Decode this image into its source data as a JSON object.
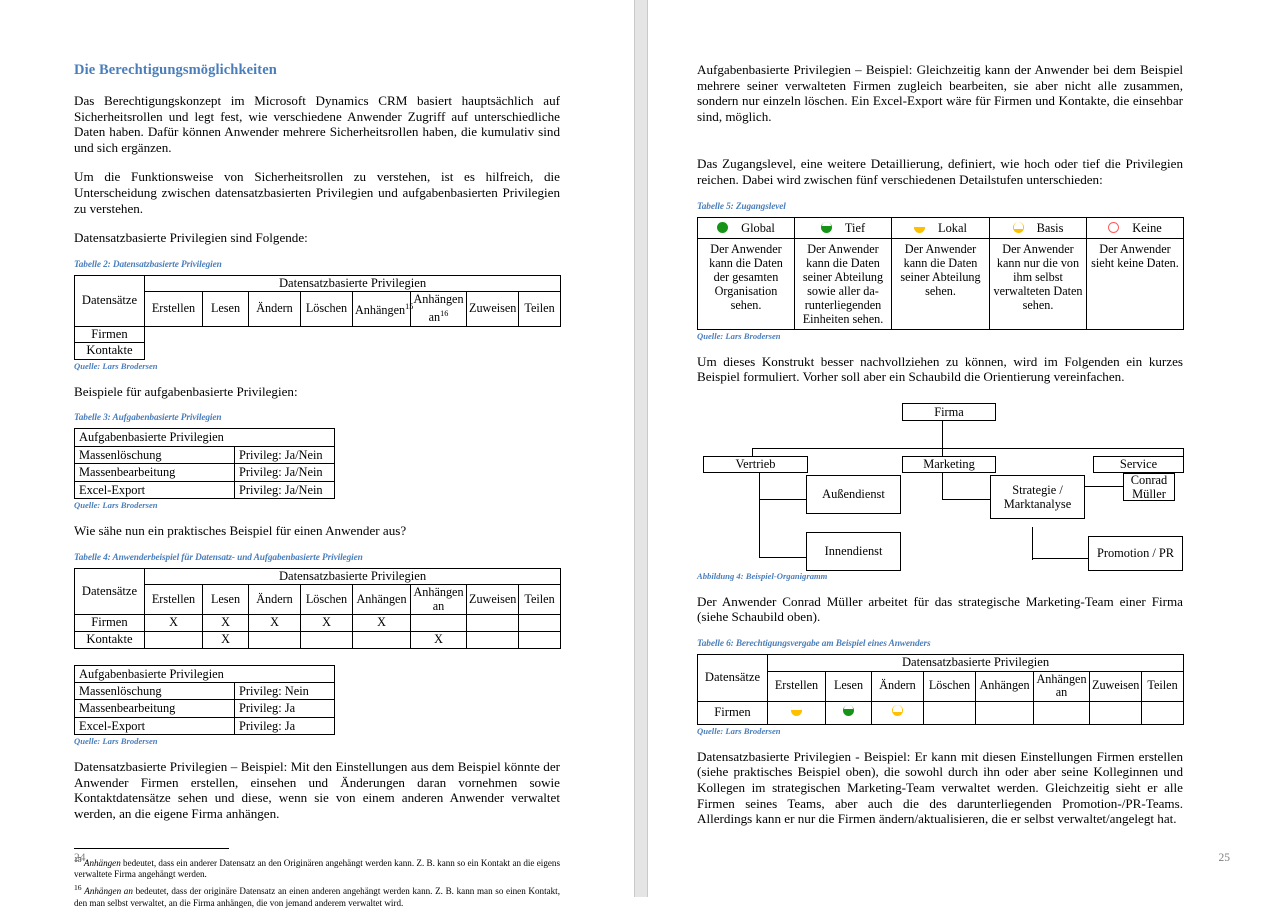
{
  "document": {
    "left_page": {
      "page_number": "24",
      "heading": "Die Berechtigungsmöglichkeiten",
      "paragraphs": {
        "p1": "Das Berechtigungskonzept im Microsoft Dynamics CRM basiert hauptsächlich auf Sicherheitsrollen und legt fest, wie verschiedene Anwender Zugriff auf unterschiedliche Daten haben. Dafür können Anwender mehrere Sicherheitsrollen haben, die kumulativ sind und sich ergänzen.",
        "p2": "Um die Funktionsweise von Sicherheitsrollen zu verstehen, ist es hilfreich, die Unterscheidung zwischen datensatzbasierten Privilegien und aufgabenbasierten Privilegien zu verstehen.",
        "p3": "Datensatzbasierte Privilegien sind Folgende:",
        "p4": "Beispiele für aufgabenbasierte Privilegien:",
        "p5": "Wie sähe nun ein praktisches Beispiel für einen Anwender aus?",
        "p6": "Datensatzbasierte Privilegien – Beispiel: Mit den Einstellungen aus dem Beispiel könnte der Anwender Firmen erstellen, einsehen und Änderungen daran vornehmen sowie Kontaktdatensätze sehen und diese, wenn sie von einem anderen Anwender verwaltet werden, an die eigene Firma anhängen."
      },
      "table2": {
        "caption": "Tabelle 2: Datensatzbasierte Privilegien",
        "source": "Quelle: Lars Brodersen",
        "span_header": "Datensatzbasierte Privilegien",
        "row_label_header": "Datensätze",
        "columns": [
          "Erstellen",
          "Lesen",
          "Ändern",
          "Löschen",
          "Anhängen",
          "Anhängen an",
          "Zuweisen",
          "Teilen"
        ],
        "footnote_markers": {
          "anhaengen": "15",
          "anhaengen_an": "16"
        },
        "rows": [
          {
            "label": "Firmen",
            "values": [
              "",
              "",
              "",
              "",
              "",
              "",
              "",
              ""
            ]
          },
          {
            "label": "Kontakte",
            "values": [
              "",
              "",
              "",
              "",
              "",
              "",
              "",
              ""
            ]
          }
        ]
      },
      "table3": {
        "caption": "Tabelle 3: Aufgabenbasierte Privilegien",
        "source": "Quelle: Lars Brodersen",
        "header": "Aufgabenbasierte Privilegien",
        "rows": [
          {
            "label": "Massenlöschung",
            "value": "Privileg: Ja/Nein"
          },
          {
            "label": "Massenbearbeitung",
            "value": "Privileg: Ja/Nein"
          },
          {
            "label": "Excel-Export",
            "value": "Privileg: Ja/Nein"
          }
        ]
      },
      "table4": {
        "caption": "Tabelle 4: Anwenderbeispiel für Datensatz- und Aufgabenbasierte Privilegien",
        "source": "Quelle: Lars Brodersen",
        "span_header": "Datensatzbasierte Privilegien",
        "row_label_header": "Datensätze",
        "columns": [
          "Erstellen",
          "Lesen",
          "Ändern",
          "Löschen",
          "Anhängen",
          "Anhängen an",
          "Zuweisen",
          "Teilen"
        ],
        "rows": [
          {
            "label": "Firmen",
            "values": [
              "X",
              "X",
              "X",
              "X",
              "X",
              "",
              "",
              ""
            ]
          },
          {
            "label": "Kontakte",
            "values": [
              "",
              "X",
              "",
              "",
              "",
              "X",
              "",
              ""
            ]
          }
        ],
        "task_header": "Aufgabenbasierte Privilegien",
        "task_rows": [
          {
            "label": "Massenlöschung",
            "value": "Privileg: Nein"
          },
          {
            "label": "Massenbearbeitung",
            "value": "Privileg: Ja"
          },
          {
            "label": "Excel-Export",
            "value": "Privileg: Ja"
          }
        ]
      },
      "footnotes": [
        {
          "marker": "15",
          "italic": "Anhängen",
          "text": " bedeutet, dass ein anderer Datensatz an den Originären angehängt werden kann. Z. B. kann so ein Kontakt an die eigens verwaltete Firma angehängt werden."
        },
        {
          "marker": "16",
          "italic": "Anhängen an",
          "text": " bedeutet, dass der originäre Datensatz an einen anderen angehängt werden kann. Z. B. kann man so einen Kontakt, den man selbst verwaltet, an die Firma anhängen, die von jemand anderem verwaltet wird."
        }
      ]
    },
    "right_page": {
      "page_number": "25",
      "paragraphs": {
        "p1": "Aufgabenbasierte Privilegien – Beispiel: Gleichzeitig kann der Anwender bei dem Beispiel mehrere seiner verwalteten Firmen zugleich bearbeiten, sie aber nicht alle zusammen, sondern nur einzeln löschen. Ein Excel-Export wäre für Firmen und Kontakte, die einsehbar sind, möglich.",
        "p2": "Das Zugangslevel, eine weitere Detaillierung, definiert, wie hoch oder tief die Privilegien reichen. Dabei wird zwischen fünf verschiedenen Detailstufen unterschieden:",
        "p3": "Um dieses Konstrukt besser nachvollziehen zu können, wird im Folgenden ein kurzes Beispiel formuliert. Vorher soll aber ein Schaubild die Orientierung vereinfachen.",
        "p4": "Der Anwender Conrad Müller arbeitet für das strategische Marketing-Team einer Firma (siehe Schaubild oben).",
        "p5": "Datensatzbasierte Privilegien - Beispiel: Er kann mit diesen Einstellungen Firmen erstellen (siehe praktisches Beispiel oben), die sowohl durch ihn oder aber seine Kolleginnen und Kollegen im strategischen Marketing-Team verwaltet werden. Gleichzeitig sieht er alle Firmen seines Teams, aber auch die des darunterliegenden Promotion-/PR-Teams. Allerdings kann er nur die Firmen ändern/aktualisieren, die er selbst verwaltet/angelegt hat."
      },
      "table5": {
        "caption": "Tabelle 5: Zugangslevel",
        "source": "Quelle: Lars Brodersen",
        "levels": [
          {
            "icon": "circle-full-green-icon",
            "name": "Global",
            "description": "Der Anwender kann die Daten der gesamten Organisation sehen."
          },
          {
            "icon": "circle-threequarter-green-icon",
            "name": "Tief",
            "description": "Der Anwender kann die Daten seiner Abteilung sowie aller da-runterliegenden Einheiten sehen."
          },
          {
            "icon": "circle-half-yellow-icon",
            "name": "Lokal",
            "description": "Der Anwender kann die Daten seiner Abteilung sehen."
          },
          {
            "icon": "circle-quarter-yellow-icon",
            "name": "Basis",
            "description": "Der Anwender kann nur die von ihm selbst verwalteten Daten sehen."
          },
          {
            "icon": "circle-empty-red-icon",
            "name": "Keine",
            "description": "Der Anwender sieht keine Daten."
          }
        ]
      },
      "organigram": {
        "caption": "Abbildung 4: Beispiel-Organigramm",
        "nodes": {
          "firma": "Firma",
          "vertrieb": "Vertrieb",
          "marketing": "Marketing",
          "service": "Service",
          "aussendienst": "Außendienst",
          "innendienst": "Innendienst",
          "strategie": "Strategie / Marktanalyse",
          "conrad": "Conrad Müller",
          "promotion": "Promotion / PR"
        }
      },
      "table6": {
        "caption": "Tabelle 6: Berechtigungsvergabe am Beispiel eines Anwenders",
        "source": "Quelle: Lars Brodersen",
        "span_header": "Datensatzbasierte Privilegien",
        "row_label_header": "Datensätze",
        "columns": [
          "Erstellen",
          "Lesen",
          "Ändern",
          "Löschen",
          "Anhängen",
          "Anhängen an",
          "Zuweisen",
          "Teilen"
        ],
        "rows": [
          {
            "label": "Firmen",
            "icons": [
              "circle-half-yellow-icon",
              "circle-threequarter-green-icon",
              "circle-quarter-yellow-icon",
              "",
              "",
              "",
              "",
              ""
            ]
          }
        ]
      }
    }
  },
  "colors": {
    "accent_blue": "#4a7ebb",
    "green": "#179418",
    "yellow": "#ffc000",
    "red": "#ff5b5b",
    "gutter": "#e5e5e5"
  }
}
